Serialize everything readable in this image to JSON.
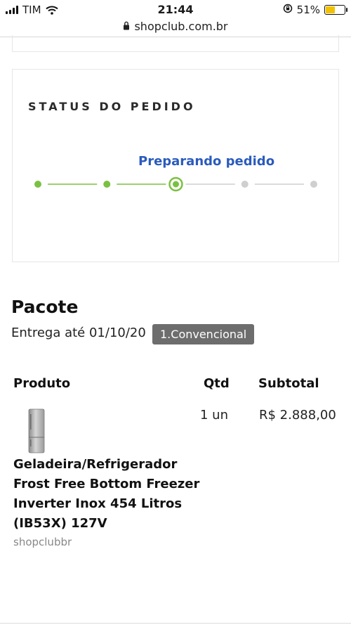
{
  "status_bar": {
    "carrier": "TIM",
    "time": "21:44",
    "battery": "51%",
    "battery_level": 0.51
  },
  "browser": {
    "url": "shopclub.com.br"
  },
  "order_status": {
    "title": "STATUS DO PEDIDO",
    "current_step_label": "Preparando pedido",
    "steps_total": 5,
    "current_step_index": 2,
    "colors": {
      "done": "#7ac142",
      "pending": "#cfcfcf",
      "label": "#2a5bbd"
    }
  },
  "package": {
    "title": "Pacote",
    "delivery_text": "Entrega até 01/10/20",
    "shipping_badge": "1.Convencional"
  },
  "table": {
    "headers": {
      "product": "Produto",
      "qty": "Qtd",
      "subtotal": "Subtotal"
    },
    "rows": [
      {
        "product_name": "Geladeira/Refrigerador Frost Free Bottom Freezer Inverter Inox 454 Litros (IB53X) 127V",
        "seller": "shopclubbr",
        "qty": "1 un",
        "subtotal": "R$ 2.888,00",
        "image_icon": "refrigerator-image"
      }
    ]
  }
}
